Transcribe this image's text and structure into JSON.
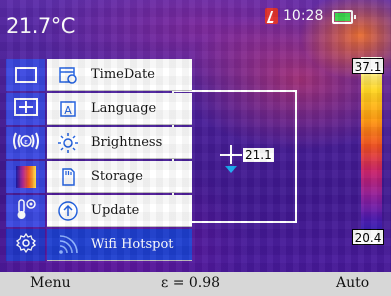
{
  "header": {
    "temperature": "21.7°C",
    "time": "10:28"
  },
  "measurement": {
    "spot_value": "21.1"
  },
  "scale": {
    "max": "37.1",
    "min": "20.4"
  },
  "menu": {
    "categories": [
      {
        "icon": "frame-icon",
        "glyph": "⬚"
      },
      {
        "icon": "target-box-icon",
        "glyph": "⊕"
      },
      {
        "icon": "emissivity-icon",
        "glyph": "©"
      },
      {
        "icon": "palette-icon",
        "glyph": "▮"
      },
      {
        "icon": "thermometer-settings-icon",
        "glyph": "🌡"
      },
      {
        "icon": "settings-gear-icon",
        "glyph": "⚙"
      }
    ],
    "items": [
      {
        "label": "TimeDate",
        "icon": "calendar-clock-icon",
        "glyph": "📅"
      },
      {
        "label": "Language",
        "icon": "language-icon",
        "glyph": "Ⓐ"
      },
      {
        "label": "Brightness",
        "icon": "brightness-icon",
        "glyph": "☀"
      },
      {
        "label": "Storage",
        "icon": "storage-card-icon",
        "glyph": "▤"
      },
      {
        "label": "Update",
        "icon": "update-arrow-icon",
        "glyph": "⇧"
      },
      {
        "label": "Wifi Hotspot",
        "icon": "wifi-icon",
        "glyph": "📶"
      }
    ],
    "selected_index": 5
  },
  "bottom_bar": {
    "left": "Menu",
    "center": "ε = 0.98",
    "right": "Auto"
  },
  "colors": {
    "menu_category": "#3a47e0",
    "menu_selected": "#1e3fd0",
    "record": "#e4332d",
    "battery": "#39d64c",
    "spot_marker": "#18a9f2"
  }
}
